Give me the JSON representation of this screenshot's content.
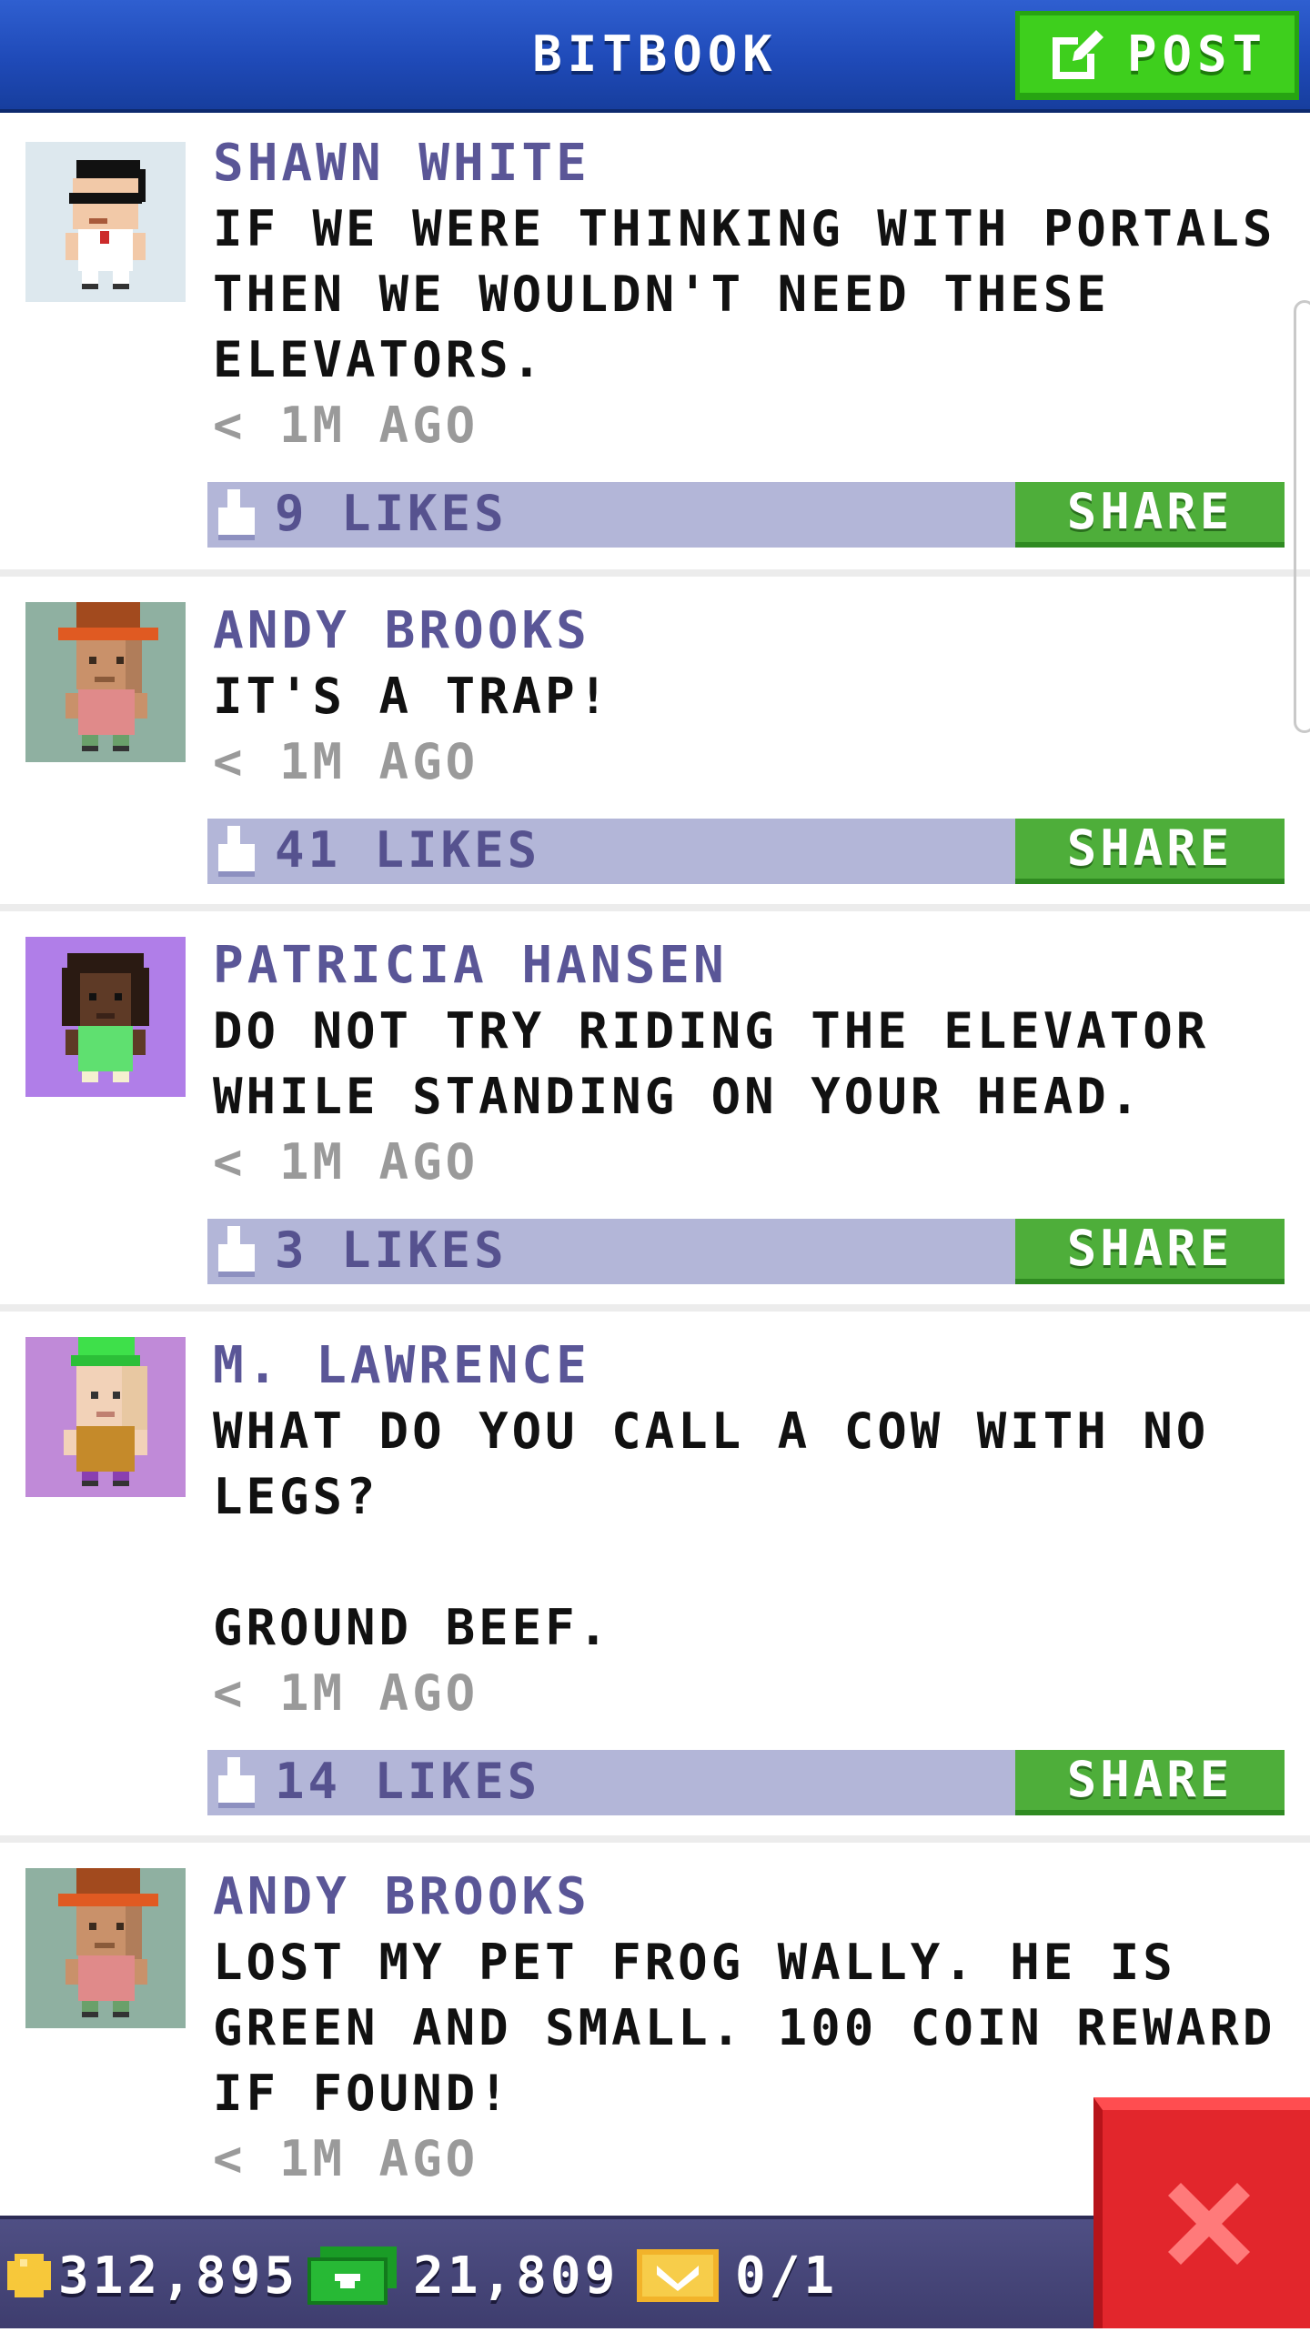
{
  "header": {
    "title": "BITBOOK",
    "post_label": "POST"
  },
  "posts": [
    {
      "author": "SHAWN WHITE",
      "message": "IF WE WERE THINKING WITH PORTALS\nTHEN WE WOULDN'T NEED THESE\nELEVATORS.",
      "time": "< 1M AGO",
      "likes": "9 LIKES",
      "share_label": "SHARE",
      "avatar_bg": "#dde8ee"
    },
    {
      "author": "ANDY BROOKS",
      "message": "IT'S A TRAP!",
      "time": "< 1M AGO",
      "likes": "41 LIKES",
      "share_label": "SHARE",
      "avatar_bg": "#8fb0a1"
    },
    {
      "author": "PATRICIA HANSEN",
      "message": "DO NOT TRY RIDING THE ELEVATOR\nWHILE STANDING ON YOUR HEAD.",
      "time": "< 1M AGO",
      "likes": "3 LIKES",
      "share_label": "SHARE",
      "avatar_bg": "#b07ee8"
    },
    {
      "author": "M. LAWRENCE",
      "message": "WHAT DO YOU CALL A COW WITH NO\nLEGS?\n\nGROUND BEEF.",
      "time": "< 1M AGO",
      "likes": "14 LIKES",
      "share_label": "SHARE",
      "avatar_bg": "#c08ad8"
    },
    {
      "author": "ANDY BROOKS",
      "message": "LOST MY PET FROG WALLY. HE IS\nGREEN AND SMALL. 100 COIN REWARD\nIF FOUND!",
      "time": "< 1M AGO",
      "avatar_bg": "#8fb0a1"
    }
  ],
  "bottom_bar": {
    "coins": "312,895",
    "bux": "21,809",
    "tickets": "0/1"
  },
  "colors": {
    "header_blue": "#2f5fd0",
    "post_green": "#3ecf1d",
    "author_purple": "#5a5697",
    "like_bar": "#b3b6d8",
    "share_green": "#4eae3a",
    "close_red": "#e2262c"
  },
  "icons": {
    "post": "edit-icon",
    "like": "thumb-up-icon",
    "coin": "coin-icon",
    "bux": "bux-icon",
    "ticket": "ticket-icon",
    "close": "close-icon"
  }
}
